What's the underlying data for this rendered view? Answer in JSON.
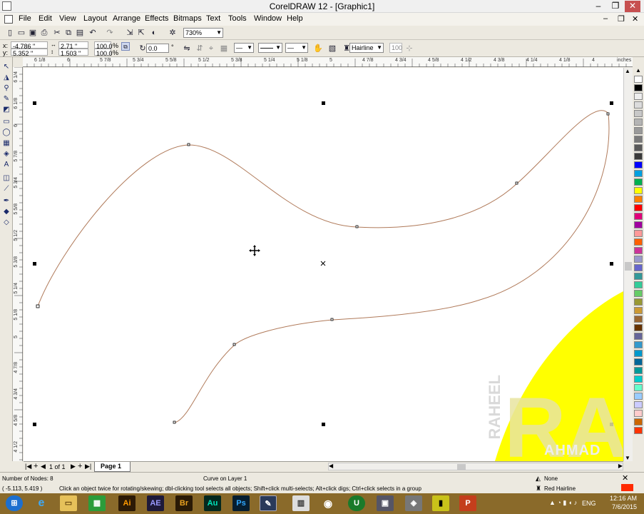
{
  "window": {
    "title": "CorelDRAW 12 - [Graphic1]",
    "min": "–",
    "restore": "❐",
    "close": "✕"
  },
  "menu": {
    "items": [
      "File",
      "Edit",
      "View",
      "Layout",
      "Arrange",
      "Effects",
      "Bitmaps",
      "Text",
      "Tools",
      "Window",
      "Help"
    ],
    "doc_controls": [
      "–",
      "❐",
      "✕"
    ]
  },
  "toolbar": {
    "zoom_value": "730%"
  },
  "property_bar": {
    "x_label": "x:",
    "x_value": "-4.786 \"",
    "y_label": "y:",
    "y_value": "5.352 \"",
    "width_value": "2.71 \"",
    "height_value": "1.503 \"",
    "scale_x": "100.0",
    "scale_y": "100.0",
    "percent": "%",
    "rotation_value": "0.0",
    "degree": "°",
    "outline_width": "Hairline",
    "smoothness": "100"
  },
  "ruler": {
    "unit": "inches",
    "h_labels": [
      "6 1/8",
      "6",
      "5 7/8",
      "5 3/4",
      "5 5/8",
      "5 1/2",
      "5 3/8",
      "5 1/4",
      "5 1/8",
      "5",
      "4 7/8",
      "4 3/4",
      "4 5/8",
      "4 1/2",
      "4 3/8",
      "4 1/4",
      "4 1/8",
      "4"
    ],
    "v_labels": [
      "6 1/4",
      "6 1/8",
      "6",
      "5 7/8",
      "5 3/4",
      "5 5/8",
      "5 1/2",
      "5 3/8",
      "5 1/4",
      "5 1/8",
      "5",
      "4 7/8",
      "4 3/4",
      "4 5/8",
      "4 1/2"
    ]
  },
  "canvas": {
    "watermark_text": "RAHEEL AHMAD",
    "curve_color": "#b07a5a",
    "yellow": "#ffff00"
  },
  "page_tabs": {
    "page_count": "1 of 1",
    "page_name": "Page 1"
  },
  "status": {
    "nodes": "Number of Nodes: 8",
    "object_info": "Curve on Layer 1",
    "coords": "( -5.113, 5.419 )",
    "hint": "Click an object twice for rotating/skewing; dbl-clicking tool selects all objects; Shift+click multi-selects; Alt+click digs; Ctrl+click selects in a group",
    "fill": "None",
    "outline": "Red  Hairline"
  },
  "taskbar": {
    "apps": [
      "Ai",
      "AE",
      "Br",
      "Au",
      "Ps"
    ],
    "language": "ENG",
    "time": "12:16 AM",
    "date": "7/6/2015"
  },
  "palette_colors": [
    "#ffffff",
    "#000000",
    "#ededed",
    "#dcdcdc",
    "#c8c8c8",
    "#b4b4b4",
    "#9a9a9a",
    "#7a7a7a",
    "#5a5a5a",
    "#3a3a3a",
    "#0000ff",
    "#00a0e0",
    "#00b050",
    "#ffff00",
    "#ff8000",
    "#ff0000",
    "#e0007a",
    "#a000a0",
    "#ff9999",
    "#ff6000",
    "#cc3399",
    "#9999cc",
    "#6666cc",
    "#339999",
    "#33cc99",
    "#66cc66",
    "#999933",
    "#cc9933",
    "#996633",
    "#663300",
    "#666699",
    "#3399cc",
    "#0099cc",
    "#006699",
    "#009999",
    "#00cccc",
    "#66ffcc",
    "#99ccff",
    "#ccccff",
    "#ffcccc",
    "#cc6600",
    "#ff3300"
  ]
}
